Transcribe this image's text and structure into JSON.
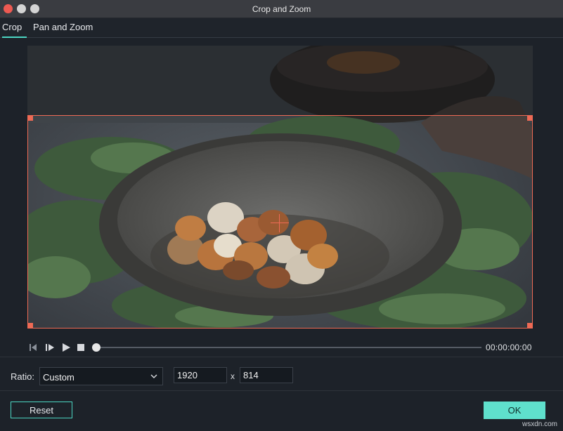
{
  "window": {
    "title": "Crop and Zoom"
  },
  "tabs": [
    {
      "label": "Crop",
      "active": true
    },
    {
      "label": "Pan and Zoom",
      "active": false
    }
  ],
  "player": {
    "timecode": "00:00:00:00",
    "progress": 0
  },
  "ratio": {
    "label": "Ratio:",
    "selected": "Custom",
    "width": "1920",
    "separator": "x",
    "height": "814"
  },
  "buttons": {
    "reset": "Reset",
    "ok": "OK"
  },
  "watermark": "wsxdn.com",
  "colors": {
    "accent": "#5fe0cc",
    "crop_frame": "#ee6a55",
    "close": "#ee5a52"
  }
}
